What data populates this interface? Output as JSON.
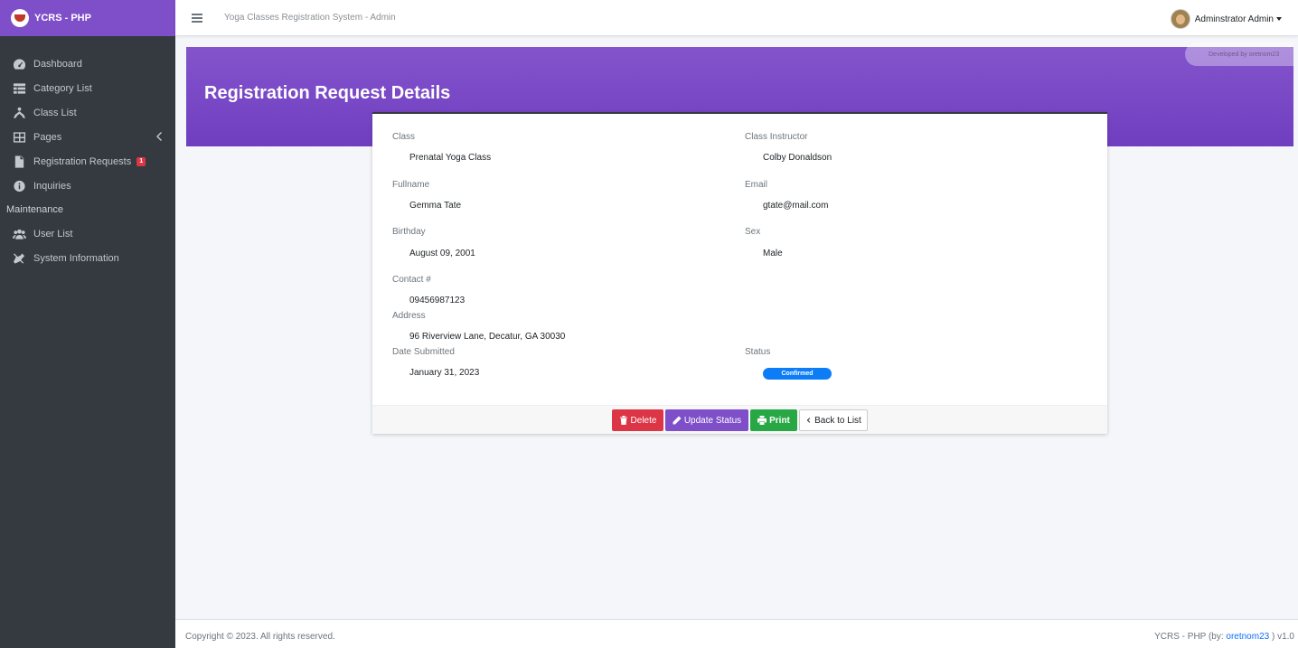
{
  "brand": {
    "name": "YCRS - PHP"
  },
  "sidebar": {
    "items": [
      {
        "label": "Dashboard",
        "icon": "dashboard-gauge-icon"
      },
      {
        "label": "Category List",
        "icon": "table-list-icon"
      },
      {
        "label": "Class List",
        "icon": "yoga-pose-icon"
      },
      {
        "label": "Pages",
        "icon": "grid-pages-icon"
      },
      {
        "label": "Registration Requests",
        "icon": "file-icon",
        "badge": "1"
      },
      {
        "label": "Inquiries",
        "icon": "info-circle-icon"
      }
    ],
    "section_header": "Maintenance",
    "maintenance_items": [
      {
        "label": "User List",
        "icon": "users-icon"
      },
      {
        "label": "System Information",
        "icon": "tools-icon"
      }
    ]
  },
  "topbar": {
    "system_title": "Yoga Classes Registration System - Admin",
    "user_name": "Adminstrator Admin"
  },
  "banner": {
    "title": "Registration Request Details",
    "developer_note": "Developed by oretnom23"
  },
  "details": {
    "class_label": "Class",
    "class_value": "Prenatal Yoga Class",
    "instructor_label": "Class Instructor",
    "instructor_value": "Colby Donaldson",
    "fullname_label": "Fullname",
    "fullname_value": "Gemma Tate",
    "email_label": "Email",
    "email_value": "gtate@mail.com",
    "birthday_label": "Birthday",
    "birthday_value": "August 09, 2001",
    "sex_label": "Sex",
    "sex_value": "Male",
    "contact_label": "Contact #",
    "contact_value": "09456987123",
    "address_label": "Address",
    "address_value": "96 Riverview Lane, Decatur, GA 30030",
    "date_label": "Date Submitted",
    "date_value": "January 31, 2023",
    "status_label": "Status",
    "status_value": "Confirmed"
  },
  "actions": {
    "delete": "Delete",
    "update": "Update Status",
    "print": "Print",
    "back": "Back to List"
  },
  "footer": {
    "copyright": "Copyright © 2023. All rights reserved.",
    "version_prefix": "YCRS - PHP (by: ",
    "author": "oretnom23",
    "version_suffix": " ) v1.0"
  },
  "colors": {
    "brand_purple": "#7e4fc9",
    "sidebar_bg": "#343a40",
    "danger": "#dc3545",
    "success": "#28a745",
    "primary": "#0d7df7"
  }
}
